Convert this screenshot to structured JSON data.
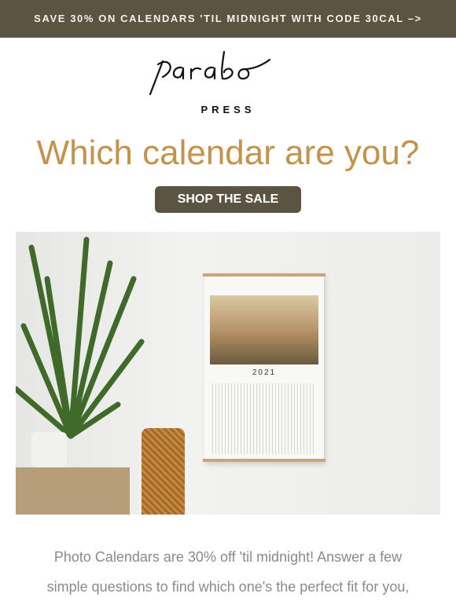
{
  "banner": {
    "text": "SAVE 30% ON CALENDARS 'TIL MIDNIGHT WITH CODE 30CAL –>"
  },
  "logo": {
    "script": "parabo",
    "sub": "PRESS"
  },
  "headline": "Which calendar are you?",
  "cta": {
    "label": "SHOP THE SALE"
  },
  "hero": {
    "calendar_year": "2021"
  },
  "body": {
    "lines": [
      "Photo Calendars are 30% off 'til midnight! Answer a few",
      "simple questions to find which one's the perfect fit for you,"
    ]
  },
  "colors": {
    "banner": "#5b5443",
    "headline": "#c4934a",
    "button": "#5b5443",
    "body_text": "#8a8a8a"
  }
}
